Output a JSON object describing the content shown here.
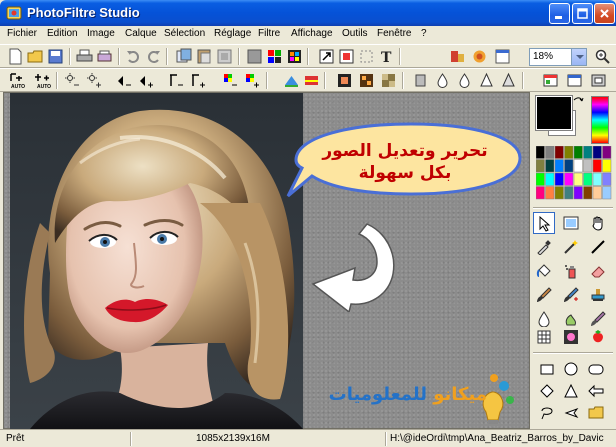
{
  "window": {
    "title": "PhotoFiltre Studio"
  },
  "menu": [
    "Fichier",
    "Edition",
    "Image",
    "Calque",
    "Sélection",
    "Réglage",
    "Filtre",
    "Affichage",
    "Outils",
    "Fenêtre",
    "?"
  ],
  "toolbar": {
    "zoom_value": "18%",
    "auto_label_1": "AUTO",
    "auto_label_2": "AUTO"
  },
  "canvas": {
    "callout_line1": "تحرير وتعديل الصور",
    "callout_line2": "بكل سهولة",
    "brand_part1": "ميكانو ",
    "brand_part2": "للمعلوميات"
  },
  "colors": {
    "foreground": "#000000",
    "background": "#ffffff",
    "callout_fill": "#fde5a0",
    "callout_border": "#4a6fd6",
    "callout_text": "#c00000",
    "brand_orange": "#f0a01e",
    "brand_blue": "#2472c8",
    "title_bar": "#0a56d8"
  },
  "palette": [
    "#000000",
    "#808080",
    "#800000",
    "#808000",
    "#008000",
    "#008080",
    "#000080",
    "#800080",
    "#808040",
    "#004040",
    "#0080ff",
    "#004080",
    "#ffffff",
    "#c0c0c0",
    "#ff0000",
    "#ffff00",
    "#00ff00",
    "#00ffff",
    "#0000ff",
    "#ff00ff",
    "#ffff80",
    "#00ff80",
    "#80ffff",
    "#8080ff",
    "#ff0080",
    "#ff8040",
    "#808000",
    "#408080",
    "#8000ff",
    "#804000",
    "#ffcc99",
    "#99ccff"
  ],
  "icons": {
    "toolbar1": [
      "new-icon",
      "open-icon",
      "save-icon",
      "print-icon",
      "scan-icon",
      "undo-icon",
      "redo-icon",
      "copy-icon",
      "paste-icon",
      "paste-as-image-icon",
      "grey-icon",
      "rgb-icon",
      "palette-icon",
      "image-size-icon",
      "canvas-size-icon",
      "crop-icon",
      "text-icon",
      "plugin-icon",
      "effects-icon",
      "window-icon",
      "zoom-icon"
    ],
    "tools": [
      "select-tool-icon",
      "magic-wand-layer-icon",
      "hand-tool-icon",
      "eyedropper-icon",
      "magic-wand-icon",
      "line-icon",
      "bucket-icon",
      "spray-icon",
      "eraser-icon",
      "brush-icon",
      "advanced-brush-icon",
      "stamp-icon",
      "smudge-icon",
      "effect-brush-icon",
      "clone-icon",
      "warp-icon",
      "mask-icon",
      "strawberry-icon",
      "rectangle-icon",
      "ellipse-icon",
      "rounded-rect-icon",
      "diamond-icon",
      "triangle-icon",
      "polygon-icon",
      "lasso-icon",
      "arrow-shape-icon",
      "folder-shape-icon"
    ]
  },
  "status": {
    "ready": "Prêt",
    "dimensions": "1085x2139x16M",
    "path": "H:\\@ideOrdi\\tmp\\Ana_Beatriz_Barros_by_Davic"
  }
}
